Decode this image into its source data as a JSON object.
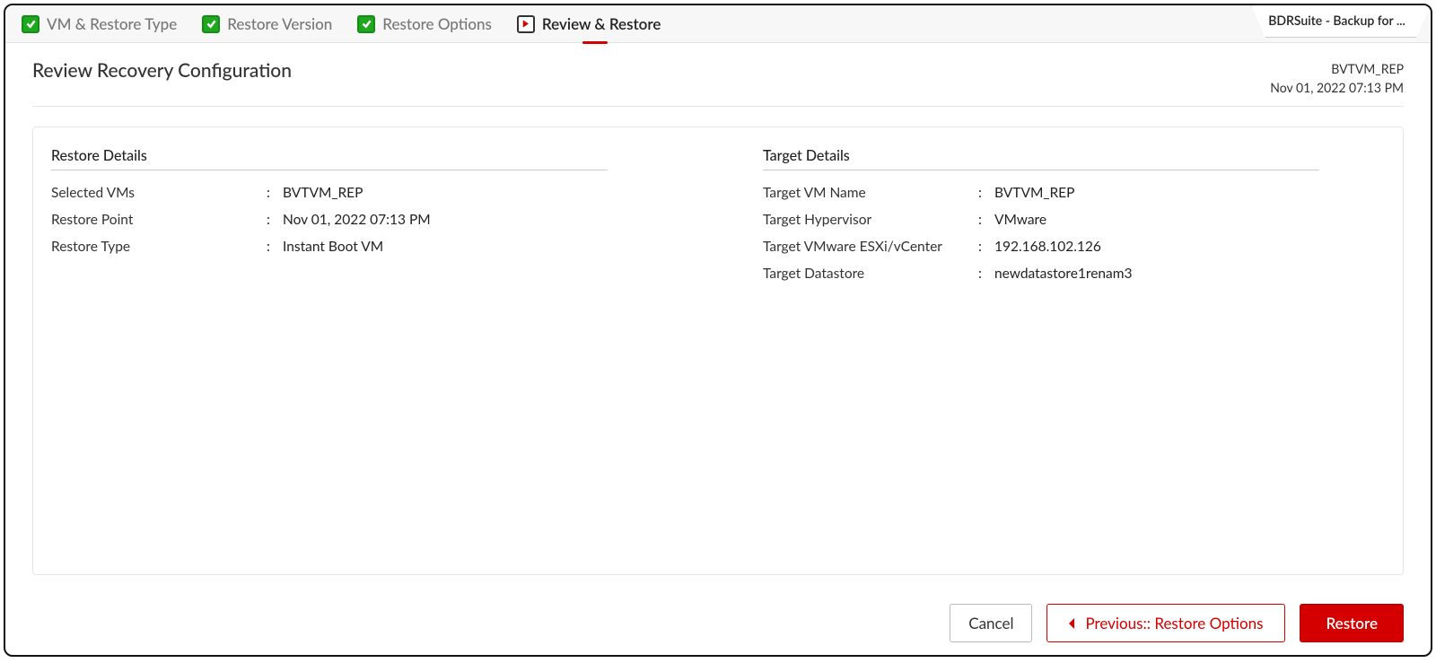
{
  "app_tab": "BDRSuite - Backup for ...",
  "steps": [
    {
      "label": "VM & Restore Type",
      "state": "done"
    },
    {
      "label": "Restore Version",
      "state": "done"
    },
    {
      "label": "Restore Options",
      "state": "done"
    },
    {
      "label": "Review & Restore",
      "state": "current"
    }
  ],
  "page_title": "Review Recovery Configuration",
  "meta": {
    "vm": "BVTVM_REP",
    "timestamp": "Nov 01, 2022 07:13 PM"
  },
  "restore_details": {
    "heading": "Restore Details",
    "rows": [
      {
        "k": "Selected VMs",
        "v": "BVTVM_REP"
      },
      {
        "k": "Restore Point",
        "v": "Nov 01, 2022 07:13 PM"
      },
      {
        "k": "Restore Type",
        "v": "Instant Boot VM"
      }
    ]
  },
  "target_details": {
    "heading": "Target Details",
    "rows": [
      {
        "k": "Target VM Name",
        "v": "BVTVM_REP"
      },
      {
        "k": "Target Hypervisor",
        "v": "VMware"
      },
      {
        "k": "Target VMware ESXi/vCenter",
        "v": "192.168.102.126"
      },
      {
        "k": "Target Datastore",
        "v": "newdatastore1renam3"
      }
    ]
  },
  "buttons": {
    "cancel": "Cancel",
    "previous": "Previous:: Restore Options",
    "primary": "Restore"
  }
}
